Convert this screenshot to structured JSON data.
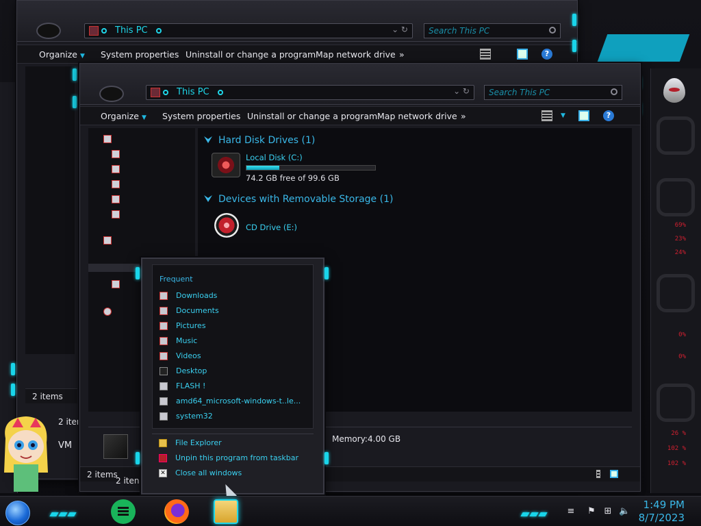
{
  "window_back": {
    "address": "This PC",
    "search_placeholder": "Search This PC",
    "toolbar": [
      "Organize",
      "System properties",
      "Uninstall or change a program",
      "Map network drive",
      "»"
    ],
    "status": "2 items",
    "status_lower": "2 iten",
    "vm_label": "VM"
  },
  "window_front": {
    "address": "This PC",
    "search_placeholder": "Search This PC",
    "toolbar": {
      "organize": "Organize",
      "system_properties": "System properties",
      "uninstall": "Uninstall or change a program",
      "map_drive": "Map network drive",
      "more": "»"
    },
    "groups": {
      "hard_disk": "Hard Disk Drives (1)",
      "removable": "Devices with Removable Storage (1)"
    },
    "drives": {
      "local_name": "Local Disk (C:)",
      "local_free": "74.2 GB free of 99.6 GB",
      "local_used_fraction": 0.255,
      "cd_name": "CD Drive (E:)"
    },
    "details": {
      "memory_label": "Memory:",
      "memory_value": "4.00 GB"
    },
    "status": "2 items",
    "status_lower": "2 iten"
  },
  "jumplist": {
    "heading": "Frequent",
    "items": [
      "Downloads",
      "Documents",
      "Pictures",
      "Music",
      "Videos",
      "Desktop",
      "FLASH !",
      "amd64_microsoft-windows-t..le...",
      "system32"
    ],
    "tasks": [
      "File Explorer",
      "Unpin this program from taskbar",
      "Close all windows"
    ]
  },
  "rail": {
    "readouts": [
      "69%",
      "23%",
      "24%",
      "0%",
      "0%",
      "26 %",
      "102 %",
      "102 %"
    ]
  },
  "taskbar": {
    "time": "1:49 PM",
    "date": "8/7/2023"
  },
  "colors": {
    "accent": "#19d5ea",
    "link": "#3ad0f0",
    "alert": "#d02030"
  }
}
